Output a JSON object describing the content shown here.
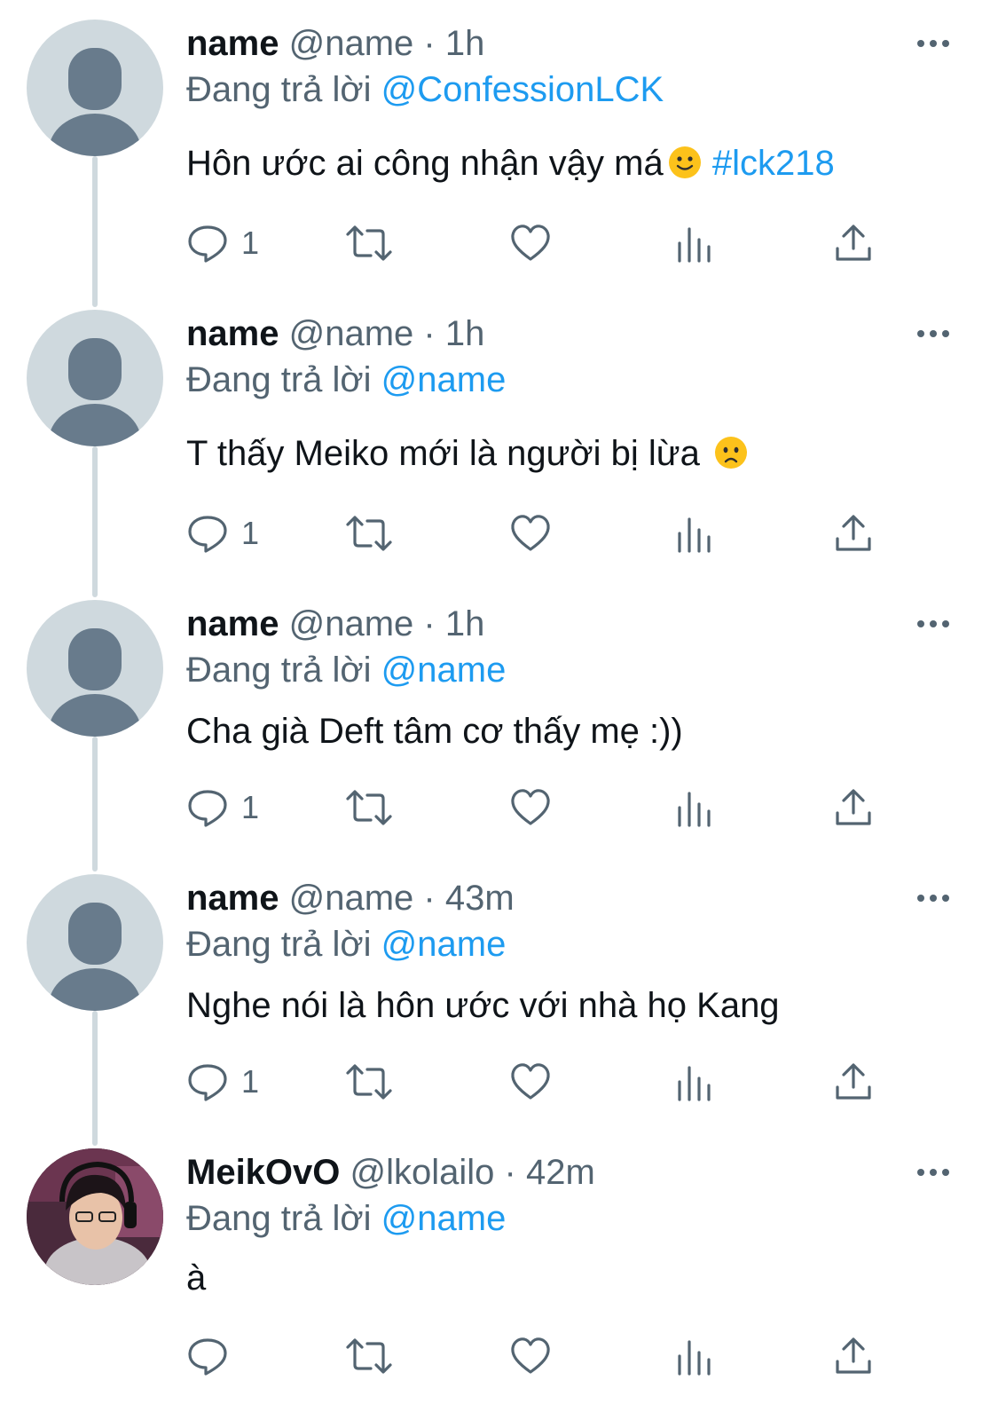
{
  "colors": {
    "accent": "#1d9bf0",
    "muted": "#536471",
    "text": "#0f1419",
    "thread_line": "#cfd9de"
  },
  "reply_prefix": "Đang trả lời",
  "tweets": [
    {
      "name": "name",
      "handle": "@name",
      "sep": "·",
      "time": "1h",
      "reply_to": "@ConfessionLCK",
      "text": "Hôn ước ai công nhận vậy má",
      "emoji": "slightly-smiling-face",
      "hashtag": "#lck218",
      "reply_count": "1"
    },
    {
      "name": "name",
      "handle": "@name",
      "sep": "·",
      "time": "1h",
      "reply_to": "@name",
      "text": "T thấy Meiko mới là người bị lừa ",
      "emoji": "frowning-face",
      "reply_count": "1"
    },
    {
      "name": "name",
      "handle": "@name",
      "sep": "·",
      "time": "1h",
      "reply_to": "@name",
      "text": "Cha già Deft tâm cơ thấy mẹ :))",
      "reply_count": "1"
    },
    {
      "name": "name",
      "handle": "@name",
      "sep": "·",
      "time": "43m",
      "reply_to": "@name",
      "text": "Nghe nói là hôn ước với nhà họ Kang",
      "reply_count": "1"
    },
    {
      "name": "MeikOvO",
      "handle": "@lkolailo",
      "sep": "·",
      "time": "42m",
      "reply_to": "@name",
      "text": "à",
      "reply_count": ""
    }
  ],
  "icons": {
    "reply": "reply-icon",
    "retweet": "retweet-icon",
    "like": "heart-icon",
    "views": "views-icon",
    "share": "share-icon",
    "more": "more-icon"
  }
}
